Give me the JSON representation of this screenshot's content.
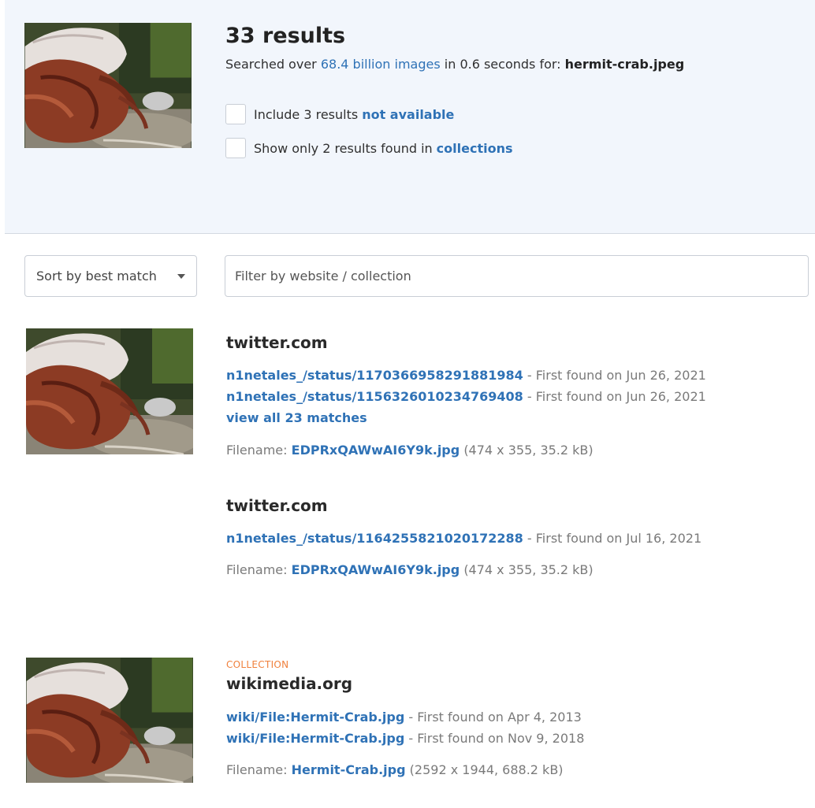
{
  "summary": {
    "count": "33 results",
    "searched_prefix": "Searched over",
    "searched_images": "68.4 billion images",
    "searched_mid": "in 0.6 seconds for:",
    "query_file": "hermit-crab.jpeg",
    "opt_unavailable_prefix": "Include 3 results",
    "opt_unavailable_link": "not available",
    "opt_collections_prefix": "Show only 2 results found in",
    "opt_collections_link": "collections"
  },
  "controls": {
    "sort_value": "Sort by best match",
    "filter_placeholder": "Filter by website / collection"
  },
  "results": [
    {
      "site": "twitter.com",
      "matches": [
        {
          "link": "n1netales_/status/1170366958291881984",
          "found": "- First found on Jun 26, 2021"
        },
        {
          "link": "n1netales_/status/1156326010234769408",
          "found": "- First found on Jun 26, 2021"
        }
      ],
      "view_all": "view all 23 matches",
      "filename_label": "Filename:",
      "filename": "EDPRxQAWwAI6Y9k.jpg",
      "file_info": "(474 x 355, 35.2 kB)"
    },
    {
      "site": "twitter.com",
      "matches": [
        {
          "link": "n1netales_/status/1164255821020172288",
          "found": "- First found on Jul 16, 2021"
        }
      ],
      "filename_label": "Filename:",
      "filename": "EDPRxQAWwAI6Y9k.jpg",
      "file_info": "(474 x 355, 35.2 kB)"
    },
    {
      "tag": "COLLECTION",
      "site": "wikimedia.org",
      "matches": [
        {
          "link": "wiki/File:Hermit-Crab.jpg",
          "found": "- First found on Apr 4, 2013"
        },
        {
          "link": "wiki/File:Hermit-Crab.jpg",
          "found": "- First found on Nov 9, 2018"
        }
      ],
      "filename_label": "Filename:",
      "filename": "Hermit-Crab.jpg",
      "file_info": "(2592 x 1944, 688.2 kB)"
    }
  ],
  "colors": {
    "link": "#2f72b6",
    "panel": "#f2f6fc",
    "collection_tag": "#f0803c"
  }
}
